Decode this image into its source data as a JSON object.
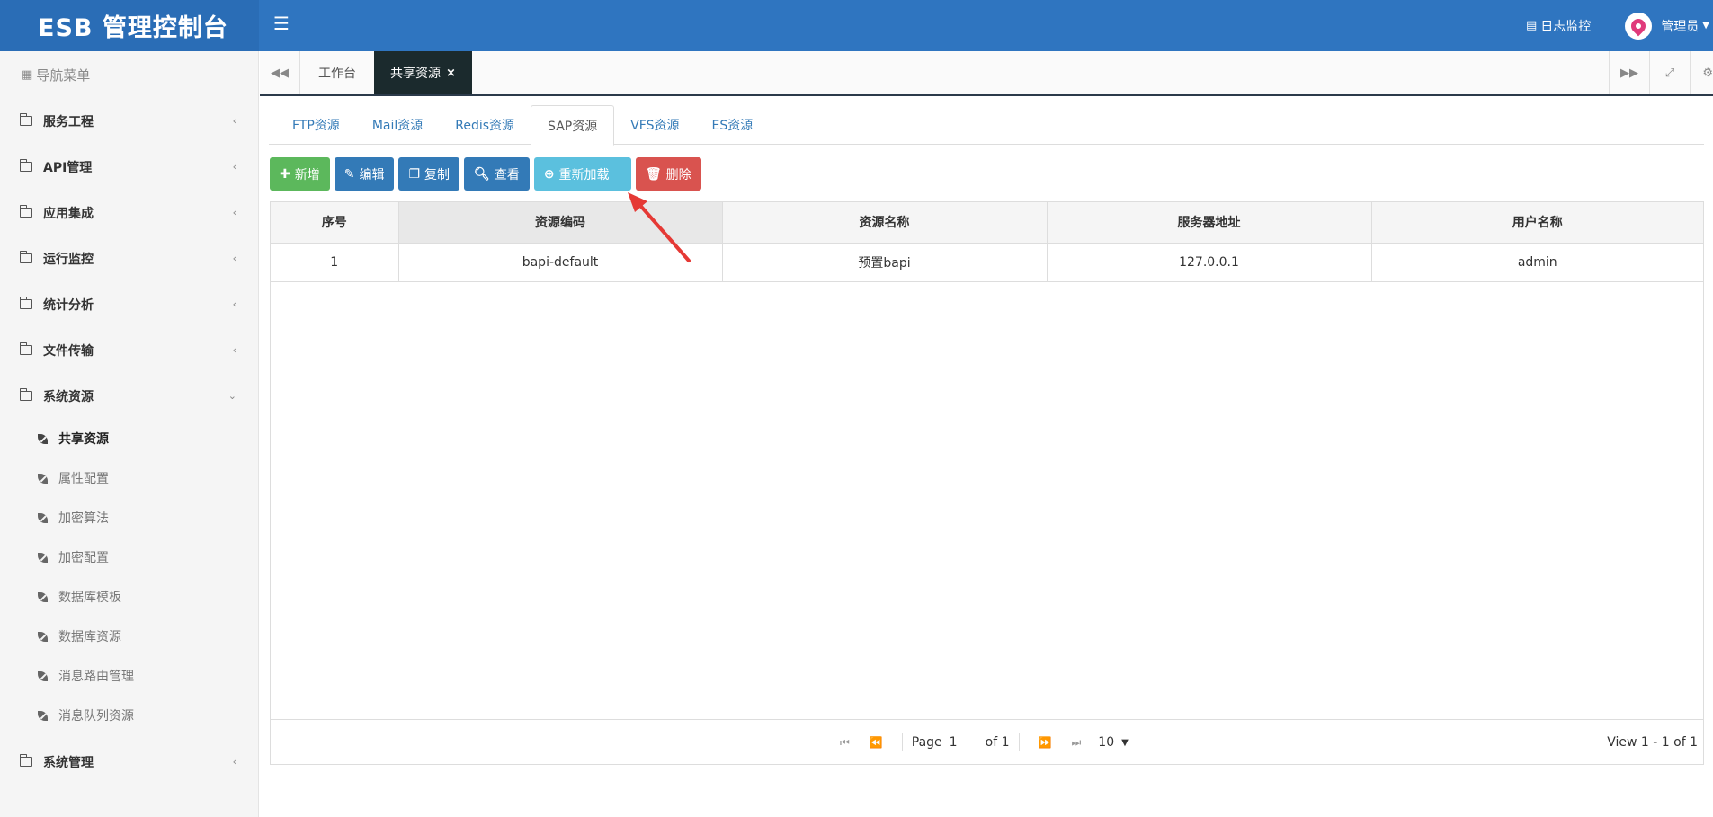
{
  "app": {
    "title": "ESB 管理控制台"
  },
  "topbar": {
    "menu_icon": "hamburger-icon",
    "log_monitor": "日志监控",
    "user_name": "管理员"
  },
  "sidebar": {
    "header": "导航菜单",
    "menus": [
      {
        "label": "服务工程"
      },
      {
        "label": "API管理"
      },
      {
        "label": "应用集成"
      },
      {
        "label": "运行监控"
      },
      {
        "label": "统计分析"
      },
      {
        "label": "文件传输"
      },
      {
        "label": "系统资源"
      }
    ],
    "submenu": [
      {
        "label": "共享资源"
      },
      {
        "label": "属性配置"
      },
      {
        "label": "加密算法"
      },
      {
        "label": "加密配置"
      },
      {
        "label": "数据库模板"
      },
      {
        "label": "数据库资源"
      },
      {
        "label": "消息路由管理"
      },
      {
        "label": "消息队列资源"
      }
    ],
    "last_menu": {
      "label": "系统管理"
    }
  },
  "pagetabs": {
    "workbench": "工作台",
    "active": "共享资源"
  },
  "restabs": [
    "FTP资源",
    "Mail资源",
    "Redis资源",
    "SAP资源",
    "VFS资源",
    "ES资源"
  ],
  "toolbar": {
    "add": "新增",
    "edit": "编辑",
    "copy": "复制",
    "view": "查看",
    "reload": "重新加载",
    "delete": "删除"
  },
  "grid": {
    "headers": [
      "序号",
      "资源编码",
      "资源名称",
      "服务器地址",
      "用户名称"
    ],
    "rows": [
      [
        "1",
        "bapi-default",
        "预置bapi",
        "127.0.0.1",
        "admin"
      ]
    ]
  },
  "pager": {
    "page_label": "Page",
    "page_value": "1",
    "of_label": "of 1",
    "page_size": "10",
    "view_text": "View 1 - 1 of 1"
  },
  "colors": {
    "topbar": "#2f75c0",
    "add": "#5cb85c",
    "primary": "#337ab7",
    "reload": "#5bc0de",
    "delete": "#d9534f",
    "arrow": "#e53935"
  }
}
